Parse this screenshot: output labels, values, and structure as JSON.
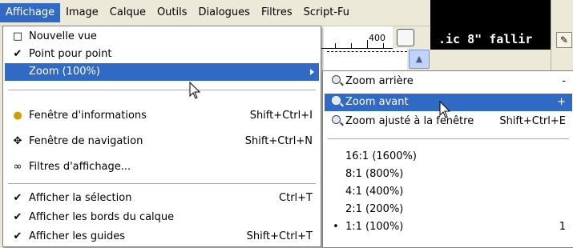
{
  "menubar": {
    "items": [
      "Affichage",
      "Image",
      "Calque",
      "Outils",
      "Dialogues",
      "Filtres",
      "Script-Fu"
    ]
  },
  "canvas": {
    "text": ".ic 8\" fallir",
    "ruler_label": "400"
  },
  "view_menu": {
    "items": [
      {
        "label": "Nouvelle vue",
        "shortcut": "",
        "icon": "page-icon"
      },
      {
        "label": "Point pour point",
        "shortcut": "",
        "icon": "check-icon"
      },
      {
        "label": "Zoom (100%)",
        "shortcut": "",
        "icon": "",
        "submenu": true,
        "highlighted": true
      },
      {
        "label": "Fenêtre d'informations",
        "shortcut": "Shift+Ctrl+I",
        "icon": "lightbulb-icon"
      },
      {
        "label": "Fenêtre de navigation",
        "shortcut": "Shift+Ctrl+N",
        "icon": "move-arrows-icon"
      },
      {
        "label": "Filtres d'affichage...",
        "shortcut": "",
        "icon": "glasses-icon"
      },
      {
        "label": "Afficher la sélection",
        "shortcut": "Ctrl+T",
        "icon": "check-icon"
      },
      {
        "label": "Afficher les bords du calque",
        "shortcut": "",
        "icon": "check-icon"
      },
      {
        "label": "Afficher les guides",
        "shortcut": "Shift+Ctrl+T",
        "icon": "check-icon"
      }
    ]
  },
  "zoom_menu": {
    "items": [
      {
        "label": "Zoom arrière",
        "shortcut": "-",
        "icon": "zoom-out-icon"
      },
      {
        "label": "Zoom avant",
        "shortcut": "+",
        "icon": "zoom-in-icon",
        "highlighted": true
      },
      {
        "label": "Zoom ajusté à la fenêtre",
        "shortcut": "Shift+Ctrl+E",
        "icon": "zoom-fit-icon"
      },
      {
        "label": "16:1 (1600%)",
        "shortcut": ""
      },
      {
        "label": "8:1 (800%)",
        "shortcut": ""
      },
      {
        "label": "4:1 (400%)",
        "shortcut": ""
      },
      {
        "label": "2:1 (200%)",
        "shortcut": ""
      },
      {
        "label": "1:1 (100%)",
        "shortcut": "1",
        "selected": true
      }
    ]
  },
  "colors": {
    "highlight": "#316ac5",
    "menubar_bg": "#ece9d8",
    "menu_bg": "#ffffff"
  }
}
